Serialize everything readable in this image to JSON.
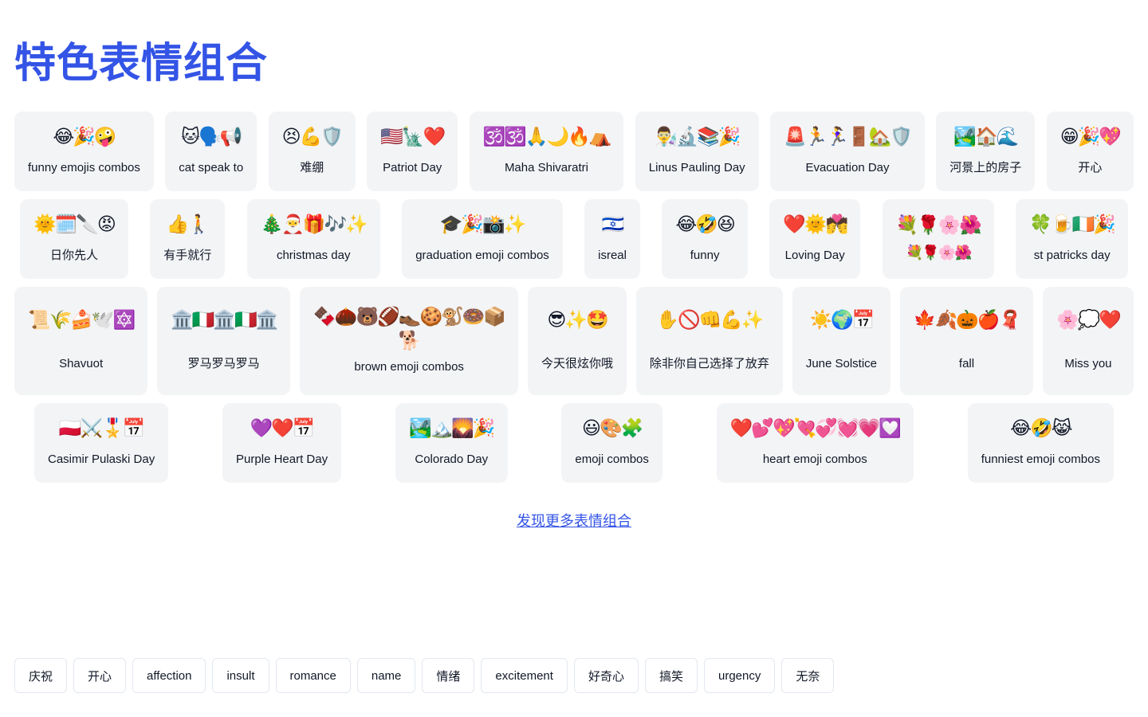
{
  "page": {
    "title": "特色表情组合",
    "more_link": "发现更多表情组合"
  },
  "rows": [
    [
      {
        "emojis": "😂🎉🤪",
        "label": "funny emojis combos"
      },
      {
        "emojis": "🐱🗣️📢",
        "label": "cat speak to"
      },
      {
        "emojis": "😣💪🛡️",
        "label": "难绷"
      },
      {
        "emojis": "🇺🇸🗽❤️",
        "label": "Patriot Day"
      },
      {
        "emojis": "🕉️🕉️🙏🌙🔥⛺",
        "label": "Maha Shivaratri"
      },
      {
        "emojis": "👨‍🔬🔬📚🎉",
        "label": "Linus Pauling Day"
      },
      {
        "emojis": "🚨🏃🏃‍♀️🚪🏡🛡️",
        "label": "Evacuation Day"
      },
      {
        "emojis": "🏞️🏠🌊",
        "label": "河景上的房子"
      },
      {
        "emojis": "😁🎉💖",
        "label": "开心"
      }
    ],
    [
      {
        "emojis": "🌞🗓️🔪😡",
        "label": "日你先人"
      },
      {
        "emojis": "👍🚶",
        "label": "有手就行"
      },
      {
        "emojis": "🎄🎅🎁🎶✨",
        "label": "christmas day"
      },
      {
        "emojis": "🎓🎉📸✨",
        "label": "graduation emoji combos"
      },
      {
        "emojis": "🇮🇱",
        "label": "isreal"
      },
      {
        "emojis": "😂🤣😆",
        "label": "funny"
      },
      {
        "emojis": "❤️🌞💏",
        "label": "Loving Day"
      },
      {
        "emojis": "💐🌹🌸🌺",
        "label": "",
        "sub_emojis": "💐🌹🌸🌺"
      },
      {
        "emojis": "🍀🍺🇮🇪🎉",
        "label": "st patricks day"
      }
    ],
    [
      {
        "emojis": "📜🌾🍰🕊️🔯",
        "label": "Shavuot"
      },
      {
        "emojis": "🏛️🇮🇹🏛️🇮🇹🏛️",
        "label": "罗马罗马罗马"
      },
      {
        "emojis": "🍫🌰🐻🏈👞🍪🐒🍩📦🐕",
        "label": "brown emoji combos"
      },
      {
        "emojis": "😎✨🤩",
        "label": "今天很炫你哦"
      },
      {
        "emojis": "✋🚫👊💪✨",
        "label": "除非你自己选择了放弃"
      },
      {
        "emojis": "☀️🌍📅",
        "label": "June Solstice"
      },
      {
        "emojis": "🍁🍂🎃🍎🧣",
        "label": "fall"
      },
      {
        "emojis": "🌸💭❤️",
        "label": "Miss you"
      }
    ],
    [
      {
        "emojis": "🇵🇱⚔️🎖️📅",
        "label": "Casimir Pulaski Day"
      },
      {
        "emojis": "💜❤️📅",
        "label": "Purple Heart Day"
      },
      {
        "emojis": "🏞️🏔️🌄🎉",
        "label": "Colorado Day"
      },
      {
        "emojis": "😃🎨🧩",
        "label": "emoji combos"
      },
      {
        "emojis": "❤️💕💖💘💞💓💗💟",
        "label": "heart emoji combos"
      },
      {
        "emojis": "😂🤣😹",
        "label": "funniest emoji combos"
      }
    ]
  ],
  "tags": [
    "庆祝",
    "开心",
    "affection",
    "insult",
    "romance",
    "name",
    "情绪",
    "excitement",
    "好奇心",
    "搞笑",
    "urgency",
    "无奈"
  ],
  "colors": {
    "accent": "#3454e6",
    "card_bg": "#f3f4f6",
    "tag_border": "#e2e8f0",
    "text": "#111827"
  }
}
